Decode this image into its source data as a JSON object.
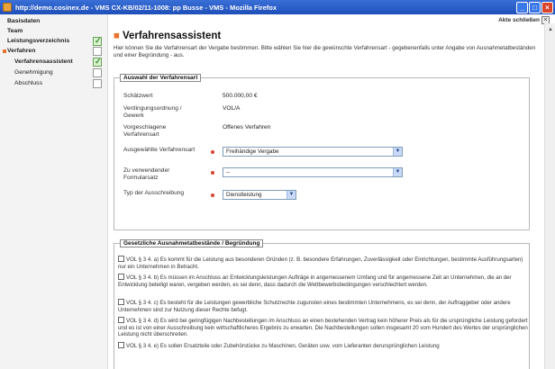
{
  "window": {
    "title": "http://demo.cosinex.de - VMS CX-KB/02/11-1008: pp Busse - VMS - Mozilla Firefox",
    "close_label": "Akte schließen"
  },
  "sidebar": {
    "items": [
      {
        "label": "Basisdaten"
      },
      {
        "label": "Team"
      },
      {
        "label": "Leistungsverzeichnis"
      },
      {
        "label": "Verfahren"
      },
      {
        "label": "Verfahrensassistent"
      },
      {
        "label": "Genehmigung"
      },
      {
        "label": "Abschluss"
      }
    ]
  },
  "main": {
    "heading": "Verfahrensassistent",
    "intro": "Hier können Sie die Verfahrensart der Vergabe bestimmen. Bitte wählen Sie hier die gewünschte Verfahrensart - gegebenenfalls unter Angabe von Ausnahmetatbeständen und einer Begründung - aus.",
    "section1": {
      "legend": "Auswahl der Verfahrensart",
      "rows": [
        {
          "label": "Schätzwert",
          "value": "500.000,00 €"
        },
        {
          "label": "Verdingungsordnung / Gewerk",
          "value": "VOL/A"
        },
        {
          "label": "Vorgeschlagene Verfahrensart",
          "value": "Offenes Verfahren"
        }
      ],
      "selects": [
        {
          "label": "Ausgewählte Verfahrensart",
          "value": "Freihändige Vergabe"
        },
        {
          "label": "Zu verwendender Formularsatz",
          "value": "--"
        },
        {
          "label": "Typ der Ausschreibung",
          "value": "Dienstleistung"
        }
      ]
    },
    "section2": {
      "legend": "Gesetzliche Ausnahmetatbestände / Begründung",
      "items": [
        "VOL § 3 4. a) Es kommt für die Leistung aus besonderen Gründen (z. B. besondere Erfahrungen, Zuverlässigkeit oder Einrichtungen, bestimmte Ausführungsarten) nur ein Unternehmen in Betracht.",
        "VOL § 3 4. b) Es müssen im Anschluss an Entwicklungsleistungen Aufträge in angemessenem Umfang und für angemessene Zeit an Unternehmen, die an der Entwicklung beteiligt waren, vergeben werden, es sei denn, dass dadurch die Wettbewerbsbedingungen verschlechtert werden.",
        "VOL § 3 4. c) Es besteht für die Leistungen gewerbliche Schutzrechte zugunsten eines bestimmten Unternehmens, es sei denn, der Auftraggeber oder andere Unternehmen sind zur Nutzung dieser Rechte befugt.",
        "VOL § 3 4. d) Es wird bei geringfügigen Nachbestellungen im Anschluss an einen bestehenden Vertrag kein höherer Preis als für die ursprüngliche Leistung gefordert und es ist von einer Ausschreibung kein wirtschaftlicheres Ergebnis zu erwarten. Die Nachbestellungen sollen insgesamt 20 vom Hundert des Wertes der ursprünglichen Leistung nicht überschreiten.",
        "VOL § 3 4. e) Es sollen Ersatzteile oder Zubehörstücke zu Maschinen, Geräten usw. vom Lieferanten derursprünglichen Leistung"
      ]
    }
  }
}
